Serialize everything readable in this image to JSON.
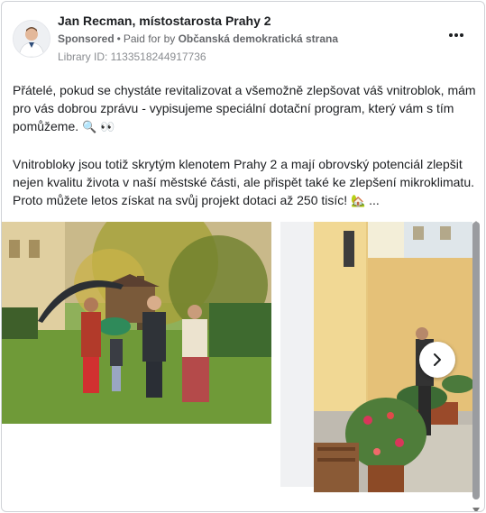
{
  "ad": {
    "page_name": "Jan Recman, místostarosta Prahy 2",
    "sponsored": "Sponsored",
    "separator": "•",
    "paid_for_prefix": "Paid for by",
    "paid_for_by": "Občanská demokratická strana",
    "library_id": "Library ID: 1133518244917736",
    "paragraph1": "Přátelé, pokud se chystáte revitalizovat a všemožně zlepšovat váš vnitroblok, mám pro vás dobrou zprávu - vypisujeme speciální dotační program, který vám s tím pomůžeme.",
    "paragraph1_emoji": "🔍 👀",
    "paragraph2": "Vnitrobloky jsou totiž skrytým klenotem Prahy 2 a mají obrovský potenciál zlepšit nejen kvalitu života v naší městské části, ale přispět také ke zlepšení mikroklimatu. Proto můžete letos získat na svůj projekt dotaci až 250 tisíc!",
    "paragraph2_emoji": "🏡",
    "ellipsis": "..."
  },
  "icons": {
    "more": "more-horizontal-icon",
    "next": "chevron-right-icon"
  },
  "colors": {
    "text": "#1c1e21",
    "secondary": "#65676b",
    "border": "#cfd2d6",
    "scrollbar": "#9a9ca0"
  }
}
